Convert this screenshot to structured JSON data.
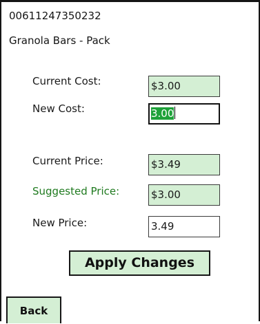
{
  "header": {
    "upc": "00611247350232",
    "product_name": "Granola Bars - Pack"
  },
  "form": {
    "current_cost": {
      "label": "Current Cost:",
      "value": "$3.00"
    },
    "new_cost": {
      "label": "New Cost:",
      "value": "3.00",
      "selected_text": "3.00"
    },
    "current_price": {
      "label": "Current Price:",
      "value": "$3.49"
    },
    "suggested_price": {
      "label": "Suggested Price:",
      "value": "$3.00"
    },
    "new_price": {
      "label": "New Price:",
      "value": "3.49"
    }
  },
  "actions": {
    "apply_label": "Apply Changes",
    "back_label": "Back"
  },
  "colors": {
    "readonly_field_bg": "#d4efd4",
    "suggested_label": "#1f7a1f",
    "selection_highlight": "#1fa23a"
  }
}
